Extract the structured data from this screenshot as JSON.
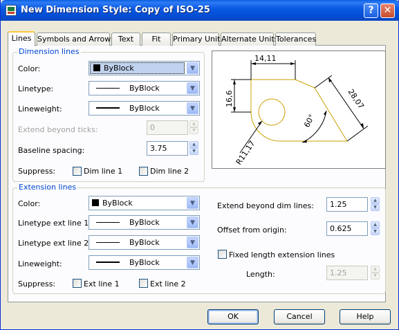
{
  "window": {
    "title": "New Dimension Style: Copy of ISO-25",
    "help_glyph": "?",
    "close_glyph": "✕"
  },
  "tabs": [
    {
      "label": "Lines",
      "active": true
    },
    {
      "label": "Symbols and Arrows",
      "active": false
    },
    {
      "label": "Text",
      "active": false
    },
    {
      "label": "Fit",
      "active": false
    },
    {
      "label": "Primary Units",
      "active": false
    },
    {
      "label": "Alternate Units",
      "active": false
    },
    {
      "label": "Tolerances",
      "active": false
    }
  ],
  "dimension_lines": {
    "legend": "Dimension lines",
    "color_label": "Color:",
    "color_value": "ByBlock",
    "linetype_label": "Linetype:",
    "linetype_value": "ByBlock",
    "lineweight_label": "Lineweight:",
    "lineweight_value": "ByBlock",
    "extend_label": "Extend beyond ticks:",
    "extend_value": "0",
    "baseline_label": "Baseline spacing:",
    "baseline_value": "3.75",
    "suppress_label": "Suppress:",
    "dim_line_1": "Dim line 1",
    "dim_line_2": "Dim line 2"
  },
  "extension_lines": {
    "legend": "Extension lines",
    "color_label": "Color:",
    "color_value": "ByBlock",
    "linetype1_label": "Linetype ext line 1:",
    "linetype1_value": "ByBlock",
    "linetype2_label": "Linetype ext line 2:",
    "linetype2_value": "ByBlock",
    "lineweight_label": "Lineweight:",
    "lineweight_value": "ByBlock",
    "suppress_label": "Suppress:",
    "ext_line_1": "Ext line 1",
    "ext_line_2": "Ext line 2",
    "extend_beyond_label": "Extend beyond dim lines:",
    "extend_beyond_value": "1.25",
    "offset_label": "Offset from origin:",
    "offset_value": "0.625",
    "fixed_length_label": "Fixed length extension lines",
    "length_label": "Length:",
    "length_value": "1.25"
  },
  "preview": {
    "dim_top": "14,11",
    "dim_left": "16,6",
    "dim_diag": "28,07",
    "dim_angle": "60°",
    "dim_radius": "R11,17"
  },
  "buttons": {
    "ok": "OK",
    "cancel": "Cancel",
    "help": "Help"
  },
  "colors": {
    "titlebar": "#0550d8",
    "legend_text": "#0046d5",
    "preview_geometry": "#c8a000"
  }
}
